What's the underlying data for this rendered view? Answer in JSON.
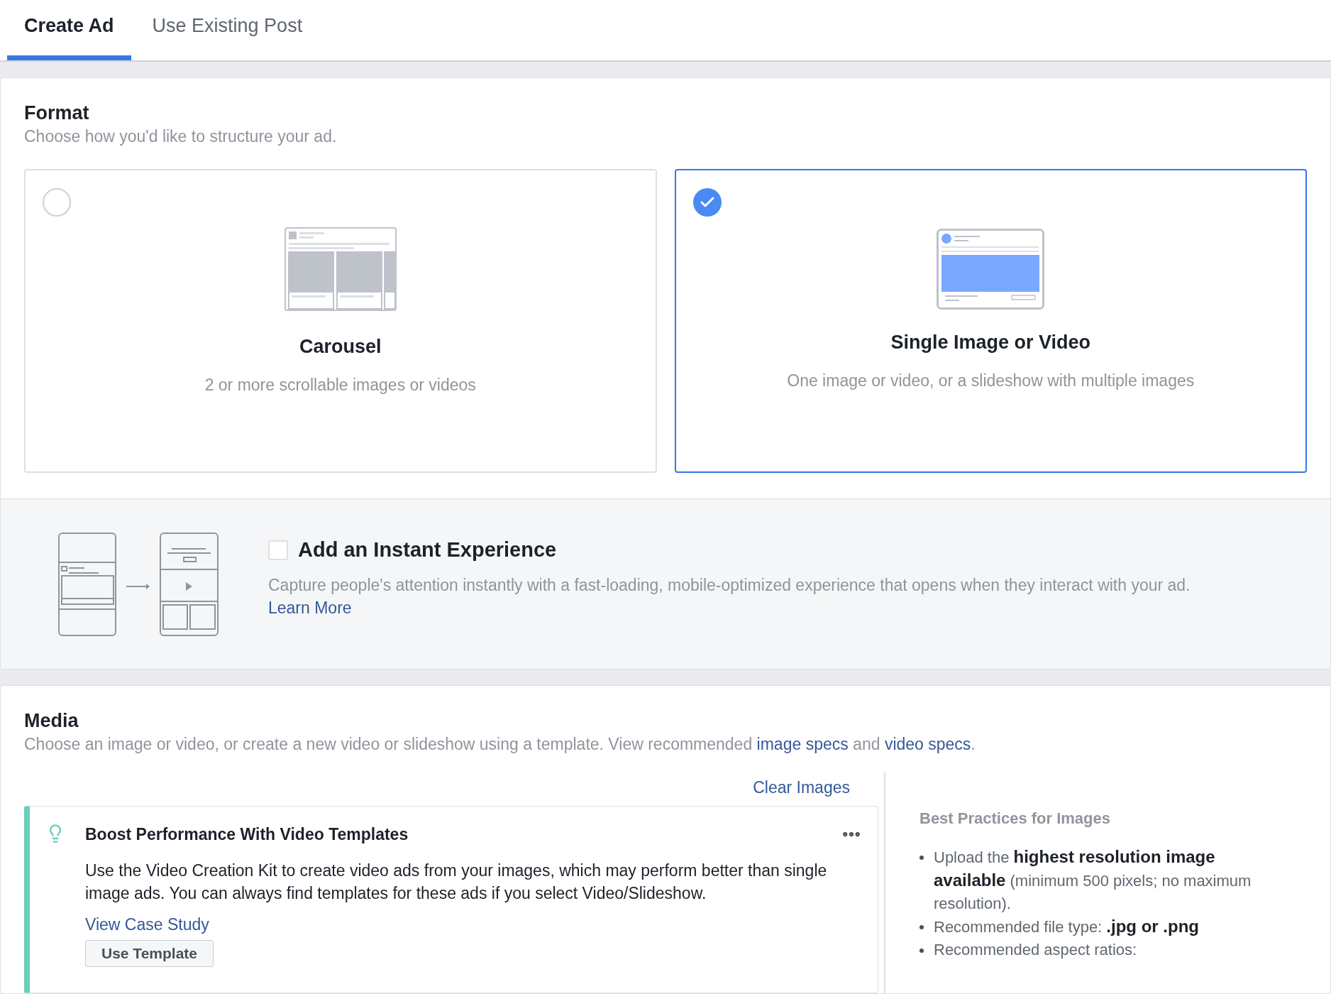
{
  "tabs": [
    {
      "label": "Create Ad",
      "selected": true
    },
    {
      "label": "Use Existing Post",
      "selected": false
    }
  ],
  "format": {
    "title": "Format",
    "subtitle": "Choose how you'd like to structure your ad.",
    "options": [
      {
        "kind": "carousel",
        "title": "Carousel",
        "description": "2 or more scrollable images or videos",
        "selected": false
      },
      {
        "kind": "single",
        "title": "Single Image or Video",
        "description": "One image or video, or a slideshow with multiple images",
        "selected": true
      }
    ]
  },
  "instant_experience": {
    "checked": false,
    "title": "Add an Instant Experience",
    "description": "Capture people's attention instantly with a fast-loading, mobile-optimized experience that opens when they interact with your ad.",
    "link": "Learn More"
  },
  "media": {
    "title": "Media",
    "description": [
      {
        "kind": "text",
        "text": "Choose an image or video, or create a new video or slideshow using a template. View recommended "
      },
      {
        "kind": "link",
        "text": "image specs"
      },
      {
        "kind": "text",
        "text": " and "
      },
      {
        "kind": "link",
        "text": "video specs"
      },
      {
        "kind": "text",
        "text": "."
      }
    ],
    "clear_images": "Clear Images",
    "tip": {
      "title": "Boost Performance With Video Templates",
      "body": "Use the Video Creation Kit to create video ads from your images, which may perform better than single image ads. You can always find templates for these ads if you select Video/Slideshow.",
      "link": "View Case Study",
      "button": "Use Template"
    },
    "best_practices": {
      "title": "Best Practices for Images",
      "items": [
        "Upload the **highest resolution image available** (minimum 500 pixels; no maximum resolution).",
        "Recommended file type: **.jpg or .png**",
        "Recommended aspect ratios:"
      ]
    }
  }
}
